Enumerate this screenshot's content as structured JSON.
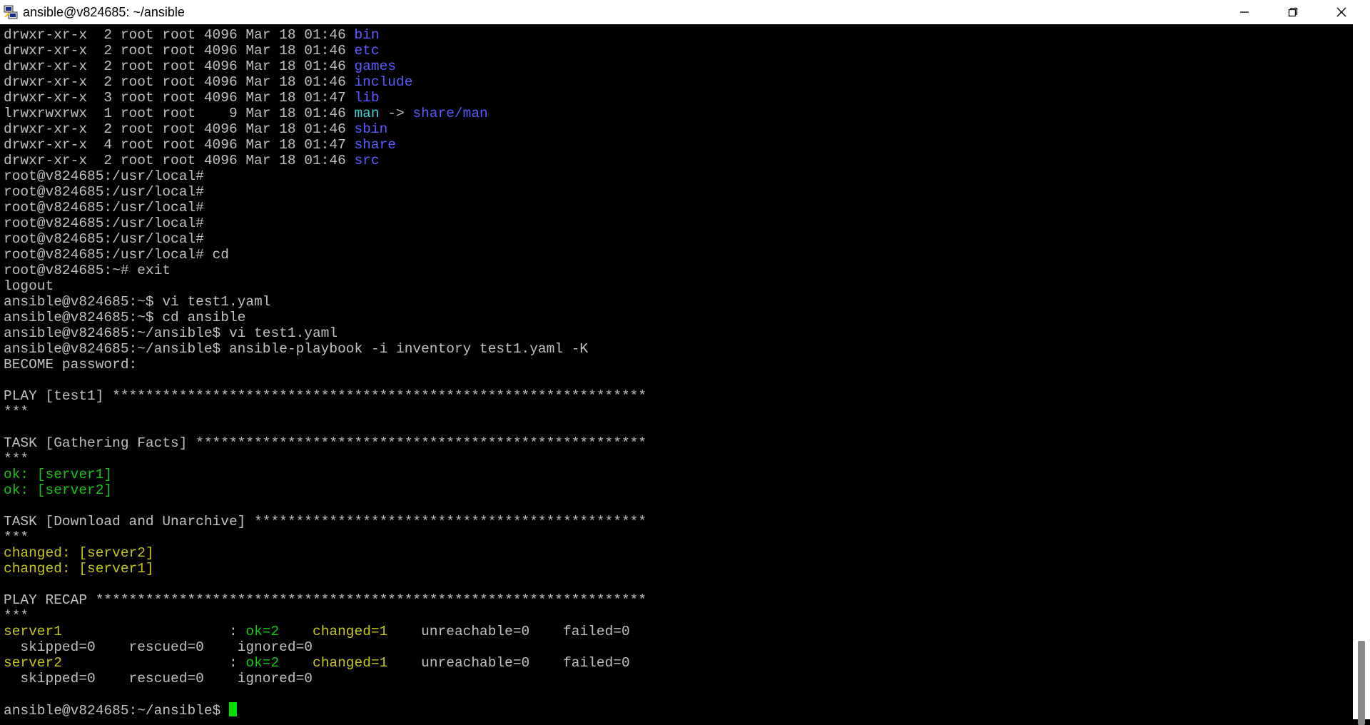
{
  "window": {
    "title": "ansible@v824685: ~/ansible",
    "icon": "putty-icon",
    "controls": [
      "minimize-icon",
      "maximize-icon",
      "close-icon"
    ]
  },
  "terminal": {
    "colors": {
      "background": "#000000",
      "foreground": "#c0c0c0",
      "directory": "#5b5bff",
      "symlink": "#3ad3d3",
      "ok": "#18c618",
      "changed": "#c6c61a",
      "cursor": "#00e000"
    },
    "lines": [
      [
        {
          "t": "drwxr-xr-x  2 root root 4096 Mar 18 01:46 "
        },
        {
          "t": "bin",
          "c": "blue"
        }
      ],
      [
        {
          "t": "drwxr-xr-x  2 root root 4096 Mar 18 01:46 "
        },
        {
          "t": "etc",
          "c": "blue"
        }
      ],
      [
        {
          "t": "drwxr-xr-x  2 root root 4096 Mar 18 01:46 "
        },
        {
          "t": "games",
          "c": "blue"
        }
      ],
      [
        {
          "t": "drwxr-xr-x  2 root root 4096 Mar 18 01:46 "
        },
        {
          "t": "include",
          "c": "blue"
        }
      ],
      [
        {
          "t": "drwxr-xr-x  3 root root 4096 Mar 18 01:47 "
        },
        {
          "t": "lib",
          "c": "blue"
        }
      ],
      [
        {
          "t": "lrwxrwxrwx  1 root root    9 Mar 18 01:46 "
        },
        {
          "t": "man",
          "c": "cyan"
        },
        {
          "t": " -> "
        },
        {
          "t": "share/man",
          "c": "blue"
        }
      ],
      [
        {
          "t": "drwxr-xr-x  2 root root 4096 Mar 18 01:46 "
        },
        {
          "t": "sbin",
          "c": "blue"
        }
      ],
      [
        {
          "t": "drwxr-xr-x  4 root root 4096 Mar 18 01:47 "
        },
        {
          "t": "share",
          "c": "blue"
        }
      ],
      [
        {
          "t": "drwxr-xr-x  2 root root 4096 Mar 18 01:46 "
        },
        {
          "t": "src",
          "c": "blue"
        }
      ],
      [
        {
          "t": "root@v824685:/usr/local#"
        }
      ],
      [
        {
          "t": "root@v824685:/usr/local#"
        }
      ],
      [
        {
          "t": "root@v824685:/usr/local#"
        }
      ],
      [
        {
          "t": "root@v824685:/usr/local#"
        }
      ],
      [
        {
          "t": "root@v824685:/usr/local#"
        }
      ],
      [
        {
          "t": "root@v824685:/usr/local# cd"
        }
      ],
      [
        {
          "t": "root@v824685:~# exit"
        }
      ],
      [
        {
          "t": "logout"
        }
      ],
      [
        {
          "t": "ansible@v824685:~$ vi test1.yaml"
        }
      ],
      [
        {
          "t": "ansible@v824685:~$ cd ansible"
        }
      ],
      [
        {
          "t": "ansible@v824685:~/ansible$ vi test1.yaml"
        }
      ],
      [
        {
          "t": "ansible@v824685:~/ansible$ ansible-playbook -i inventory test1.yaml -K"
        }
      ],
      [
        {
          "t": "BECOME password:"
        }
      ],
      [],
      [
        {
          "t": "PLAY [test1] ****************************************************************"
        }
      ],
      [
        {
          "t": "***"
        }
      ],
      [],
      [
        {
          "t": "TASK [Gathering Facts] ******************************************************"
        }
      ],
      [
        {
          "t": "***"
        }
      ],
      [
        {
          "t": "ok: [server1]",
          "c": "green"
        }
      ],
      [
        {
          "t": "ok: [server2]",
          "c": "green"
        }
      ],
      [],
      [
        {
          "t": "TASK [Download and Unarchive] ***********************************************"
        }
      ],
      [
        {
          "t": "***"
        }
      ],
      [
        {
          "t": "changed: [server2]",
          "c": "yellow"
        }
      ],
      [
        {
          "t": "changed: [server1]",
          "c": "yellow"
        }
      ],
      [],
      [
        {
          "t": "PLAY RECAP ******************************************************************"
        }
      ],
      [
        {
          "t": "***"
        }
      ],
      [
        {
          "t": "server1",
          "c": "yellow"
        },
        {
          "t": "                    : "
        },
        {
          "t": "ok=2",
          "c": "green"
        },
        {
          "t": "    "
        },
        {
          "t": "changed=1",
          "c": "yellow"
        },
        {
          "t": "    unreachable=0    failed=0"
        }
      ],
      [
        {
          "t": "  skipped=0    rescued=0    ignored=0"
        }
      ],
      [
        {
          "t": "server2",
          "c": "yellow"
        },
        {
          "t": "                    : "
        },
        {
          "t": "ok=2",
          "c": "green"
        },
        {
          "t": "    "
        },
        {
          "t": "changed=1",
          "c": "yellow"
        },
        {
          "t": "    unreachable=0    failed=0"
        }
      ],
      [
        {
          "t": "  skipped=0    rescued=0    ignored=0"
        }
      ],
      [],
      [
        {
          "t": "ansible@v824685:~/ansible$ "
        },
        {
          "cursor": true
        }
      ]
    ]
  }
}
